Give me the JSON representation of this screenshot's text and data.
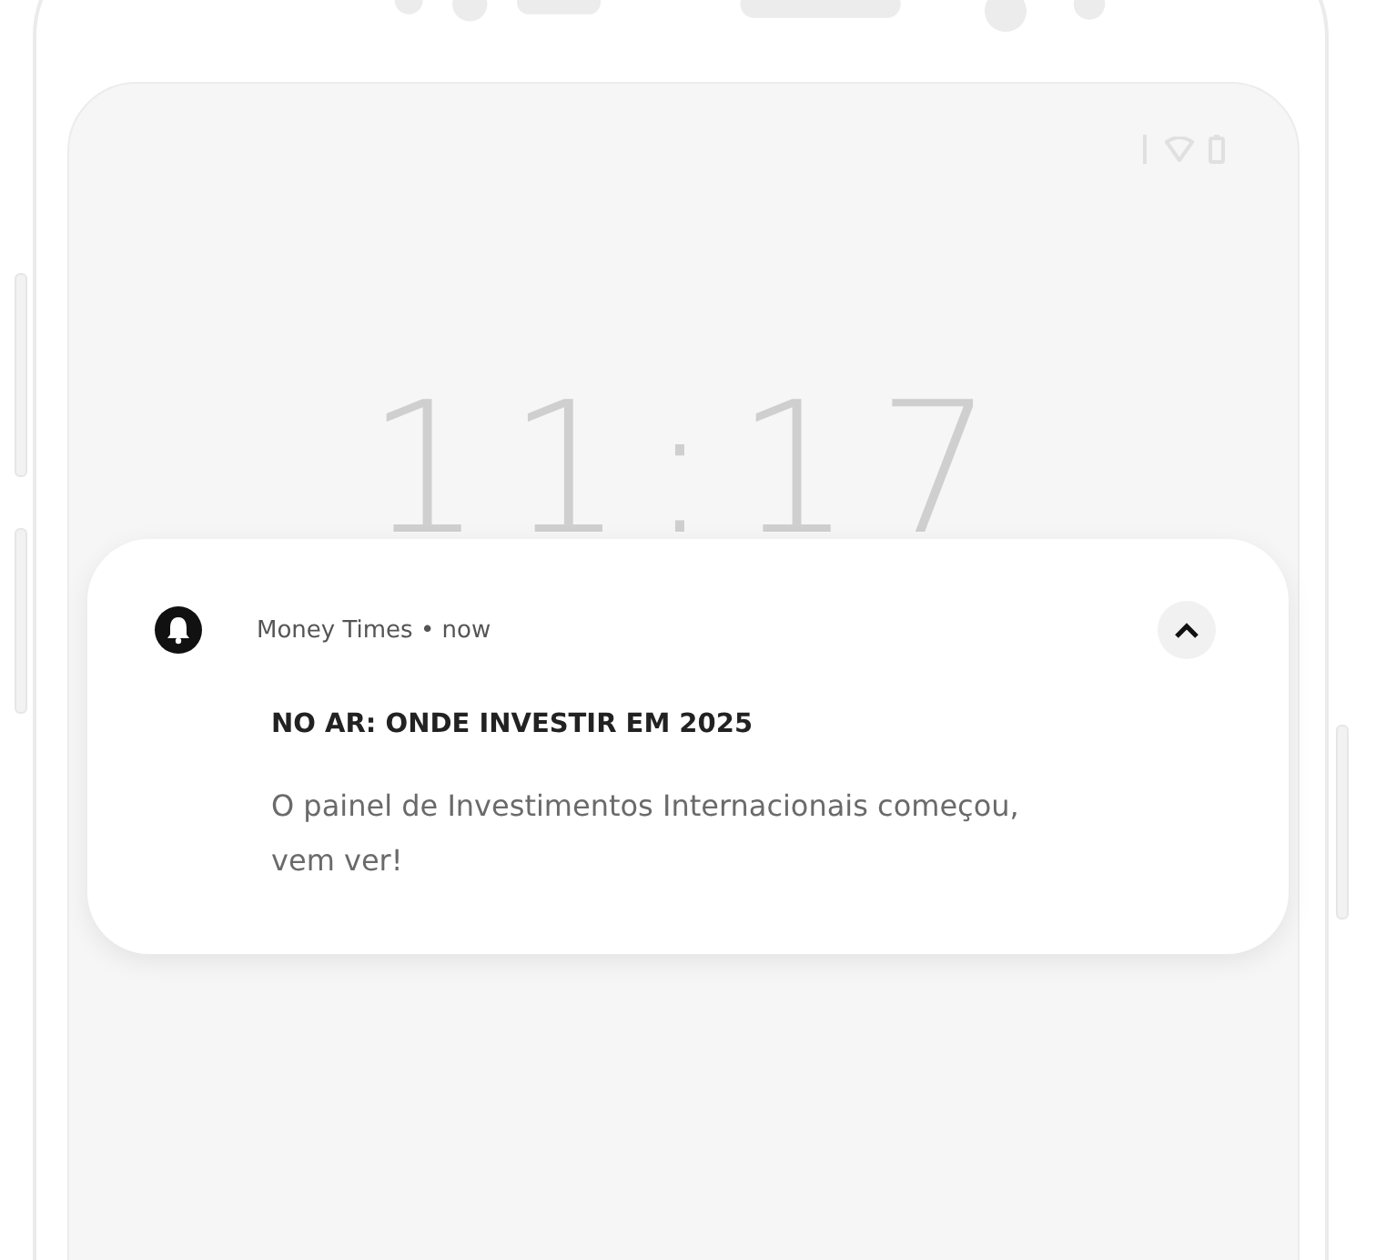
{
  "lock_screen": {
    "clock": "11:17"
  },
  "notification": {
    "header": "Money Times • now",
    "title": "NO AR: ONDE INVESTIR EM 2025",
    "body": "O painel de Investimentos Internacionais começou, vem ver!",
    "expanded": true
  }
}
